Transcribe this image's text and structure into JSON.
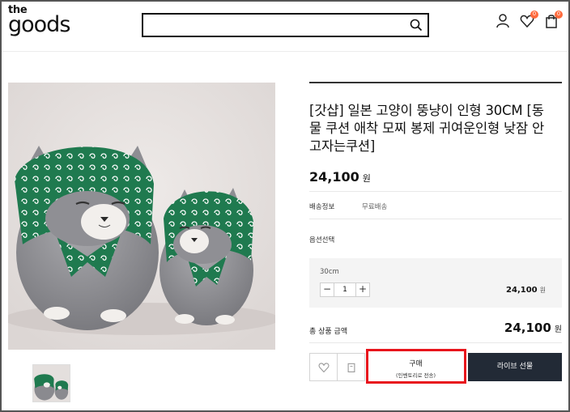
{
  "brand": {
    "top": "the",
    "bottom": "goods"
  },
  "search": {
    "value": "",
    "placeholder": ""
  },
  "header_icons": [
    {
      "name": "user-icon",
      "badge": ""
    },
    {
      "name": "heart-icon",
      "badge": "0"
    },
    {
      "name": "bag-icon",
      "badge": "0"
    }
  ],
  "product": {
    "title": "[갓샵] 일본 고양이 뚱냥이 인형 30CM [동물 쿠션 애착 모찌 봉제 귀여운인형 낮잠 안고자는쿠션]",
    "price": "24,100",
    "currency": "원",
    "shipping_label": "배송정보",
    "shipping_value": "무료배송",
    "option_label": "옵션선택",
    "option": {
      "name": "30cm",
      "qty": "1",
      "minus": "−",
      "plus": "+",
      "price": "24,100",
      "currency": "원"
    },
    "total_label": "총 상품 금액",
    "total_price": "24,100",
    "total_currency": "원"
  },
  "actions": {
    "buy_line1": "구매",
    "buy_line2": "(인벤토리로 전송)",
    "gift_label": "라이브 선물"
  },
  "colors": {
    "accent": "#e8141c",
    "gift_bg": "#222a36",
    "badge": "#ff6b3d",
    "scarf": "#1f7a4f"
  }
}
